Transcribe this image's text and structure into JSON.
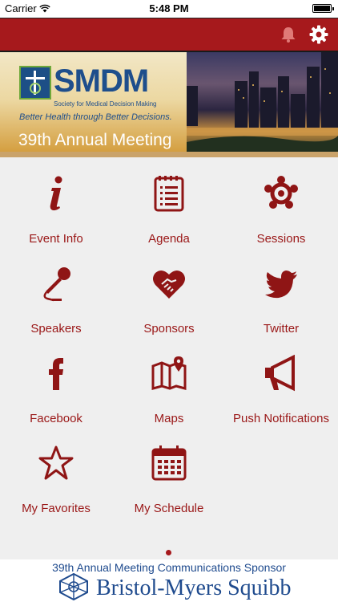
{
  "status_bar": {
    "carrier": "Carrier",
    "time": "5:48 PM"
  },
  "nav": {
    "bell_icon": "bell-icon",
    "settings_icon": "gear-icon",
    "bar_color": "#a6191c"
  },
  "banner": {
    "logo": "SMDM",
    "org_name": "Society for Medical Decision Making",
    "tagline": "Better Health through Better Decisions.",
    "meeting_title": "39th Annual Meeting"
  },
  "menu": [
    {
      "label": "Event Info",
      "icon": "info-icon"
    },
    {
      "label": "Agenda",
      "icon": "agenda-icon"
    },
    {
      "label": "Sessions",
      "icon": "sessions-icon"
    },
    {
      "label": "Speakers",
      "icon": "microphone-icon"
    },
    {
      "label": "Sponsors",
      "icon": "heart-handshake-icon"
    },
    {
      "label": "Twitter",
      "icon": "twitter-icon"
    },
    {
      "label": "Facebook",
      "icon": "facebook-icon"
    },
    {
      "label": "Maps",
      "icon": "map-icon"
    },
    {
      "label": "Push Notifications",
      "icon": "megaphone-icon"
    },
    {
      "label": "My Favorites",
      "icon": "star-icon"
    },
    {
      "label": "My Schedule",
      "icon": "calendar-icon"
    }
  ],
  "pager": {
    "page": 1
  },
  "sponsor": {
    "caption": "39th Annual Meeting Communications Sponsor",
    "name": "Bristol-Myers Squibb"
  },
  "colors": {
    "accent": "#a6191c",
    "label": "#9a1717",
    "sponsor_blue": "#1f4b8e"
  }
}
